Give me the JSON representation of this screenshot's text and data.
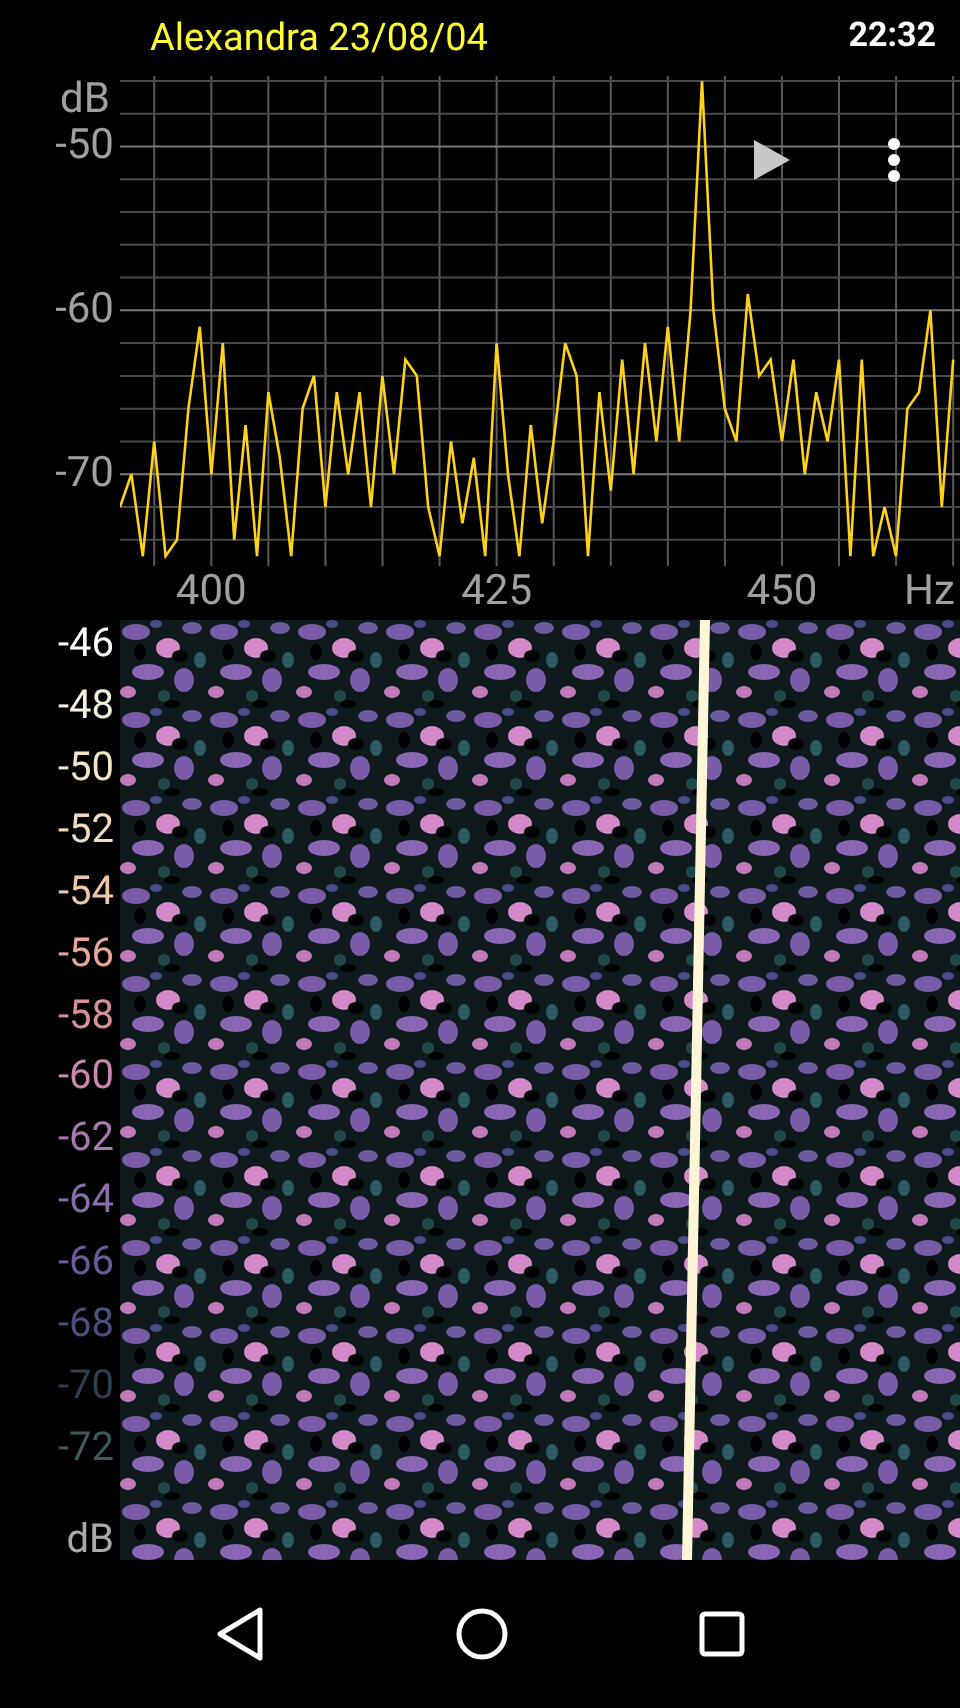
{
  "status_bar": {
    "title": "Alexandra 23/08/04",
    "time": "22:32"
  },
  "spectrum": {
    "chart_data": {
      "type": "line",
      "grid": true,
      "xlabel": "Hz",
      "ylabel": "dB",
      "xlim": [
        392,
        465.6
      ],
      "ylim": [
        -75.6,
        -45.7
      ],
      "xticks": [
        400,
        425,
        450
      ],
      "yticks": [
        -50,
        -60,
        -70
      ],
      "x": [
        392,
        393,
        394,
        395,
        396,
        397,
        398,
        399,
        400,
        401,
        402,
        403,
        404,
        405,
        406,
        407,
        408,
        409,
        410,
        411,
        412,
        413,
        414,
        415,
        416,
        417,
        418,
        419,
        420,
        421,
        422,
        423,
        424,
        425,
        426,
        427,
        428,
        429,
        430,
        431,
        432,
        433,
        434,
        435,
        436,
        437,
        438,
        439,
        440,
        441,
        442,
        443,
        444,
        445,
        446,
        447,
        448,
        449,
        450,
        451,
        452,
        453,
        454,
        455,
        456,
        457,
        458,
        459,
        460,
        461,
        462,
        463,
        464,
        465
      ],
      "series": [
        {
          "color": "#ffd21a",
          "values": [
            -72,
            -70,
            -75,
            -68,
            -75,
            -74,
            -66,
            -61,
            -70,
            -62,
            -74,
            -67,
            -75,
            -65,
            -69,
            -75,
            -66,
            -64,
            -72,
            -65,
            -70,
            -65,
            -72,
            -64,
            -70,
            -63,
            -64,
            -72,
            -75,
            -68,
            -73,
            -69,
            -75,
            -62,
            -70,
            -75,
            -67,
            -73,
            -68,
            -62,
            -64,
            -75,
            -65,
            -71,
            -63,
            -70,
            -62,
            -68,
            -61,
            -68,
            -60,
            -46,
            -60,
            -66,
            -68,
            -59,
            -64,
            -63,
            -68,
            -63,
            -70,
            -65,
            -68,
            -63,
            -75,
            -63,
            -75,
            -72,
            -75,
            -66,
            -65,
            -60,
            -72,
            -63
          ]
        }
      ]
    }
  },
  "spectrogram": {
    "unit": "dB",
    "scale": [
      {
        "label": "-46",
        "color": "#ffffff"
      },
      {
        "label": "-48",
        "color": "#f4f0e0"
      },
      {
        "label": "-50",
        "color": "#f0e6c8"
      },
      {
        "label": "-52",
        "color": "#f2dcc0"
      },
      {
        "label": "-54",
        "color": "#f0c8a8"
      },
      {
        "label": "-56",
        "color": "#e8a898"
      },
      {
        "label": "-58",
        "color": "#d89098"
      },
      {
        "label": "-60",
        "color": "#c888b0"
      },
      {
        "label": "-62",
        "color": "#a878b0"
      },
      {
        "label": "-64",
        "color": "#8c6cac"
      },
      {
        "label": "-66",
        "color": "#6c5c9c"
      },
      {
        "label": "-68",
        "color": "#4c5080"
      },
      {
        "label": "-70",
        "color": "#2c4050"
      },
      {
        "label": "-72",
        "color": "#3e5a5a"
      }
    ]
  }
}
